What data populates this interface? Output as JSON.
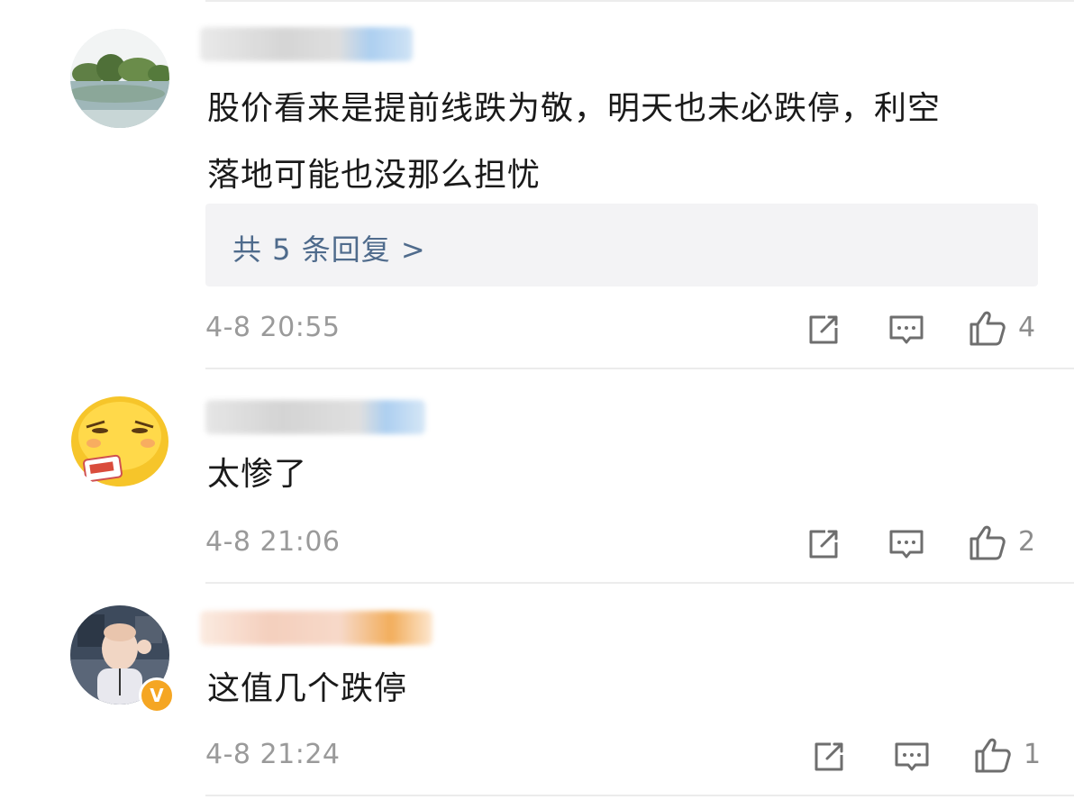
{
  "comments": [
    {
      "text_line1": "股价看来是提前线跌为敬，明天也未必跌停，利空",
      "text_line2": "落地可能也没那么担忧",
      "replies_label": "共 5 条回复 >",
      "time": "4-8 20:55",
      "likes": "4",
      "avatar": "landscape-avatar",
      "username_colors": [
        "#d9d9d9",
        "#9fc7ee"
      ]
    },
    {
      "text": "太惨了",
      "time": "4-8 21:06",
      "likes": "2",
      "avatar": "emoji-face-avatar",
      "username_colors": [
        "#d0d0d0",
        "#9fc7ee"
      ]
    },
    {
      "text": "这值几个跌停",
      "time": "4-8 21:24",
      "likes": "1",
      "avatar": "photo-avatar",
      "verified": true,
      "username_colors": [
        "#f3c7b2",
        "#f0a040"
      ]
    }
  ],
  "icons": [
    "share-icon",
    "comment-icon",
    "like-icon"
  ],
  "colors": {
    "link": "#4f6b8c",
    "meta": "#9a9a9a",
    "reply_bg": "#f3f3f5",
    "verified": "#f5a623"
  }
}
